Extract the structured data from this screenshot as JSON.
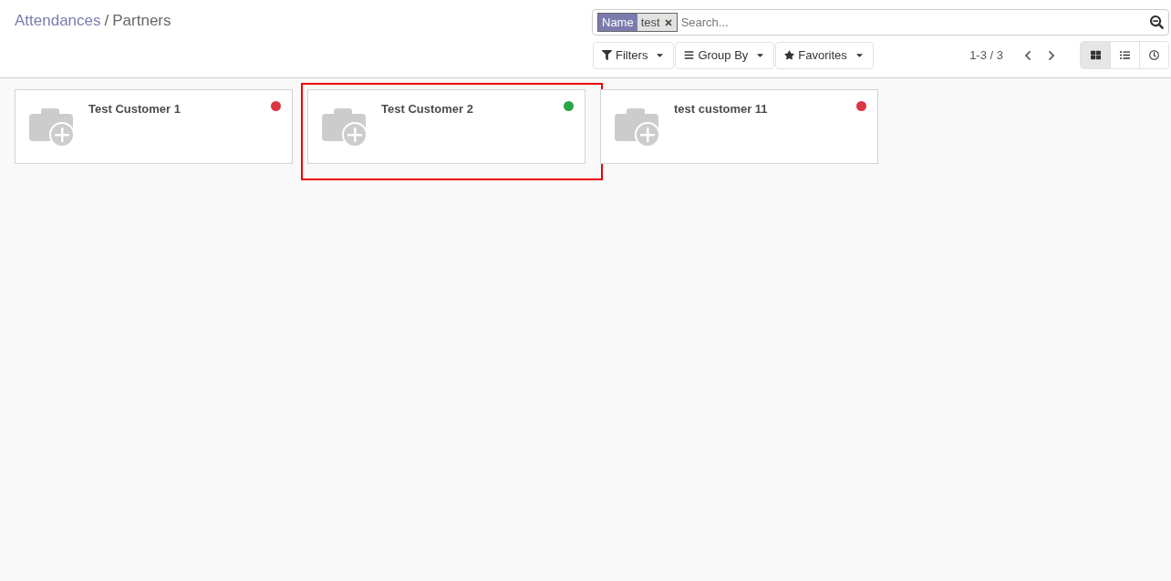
{
  "breadcrumb": [
    {
      "label": "Attendances",
      "link": true
    },
    {
      "label": "Partners",
      "link": false
    }
  ],
  "breadcrumb_separator": "/",
  "search": {
    "facet": {
      "label": "Name",
      "value": "test"
    },
    "placeholder": "Search..."
  },
  "filters": [
    {
      "label": "Filters",
      "kind": "filter"
    },
    {
      "label": "Group By",
      "kind": "group"
    },
    {
      "label": "Favorites",
      "kind": "star"
    }
  ],
  "pager": "1-3 / 3",
  "views": [
    {
      "kind": "kanban",
      "selected": true
    },
    {
      "kind": "list",
      "selected": false
    },
    {
      "kind": "activity",
      "selected": false
    }
  ],
  "cards": [
    {
      "name": "Test Customer 1",
      "color": "#dc3545",
      "highlighted": false
    },
    {
      "name": "Test Customer 2",
      "color": "#28a745",
      "highlighted": true
    },
    {
      "name": "test customer 11",
      "color": "#dc3545",
      "highlighted": false
    }
  ]
}
